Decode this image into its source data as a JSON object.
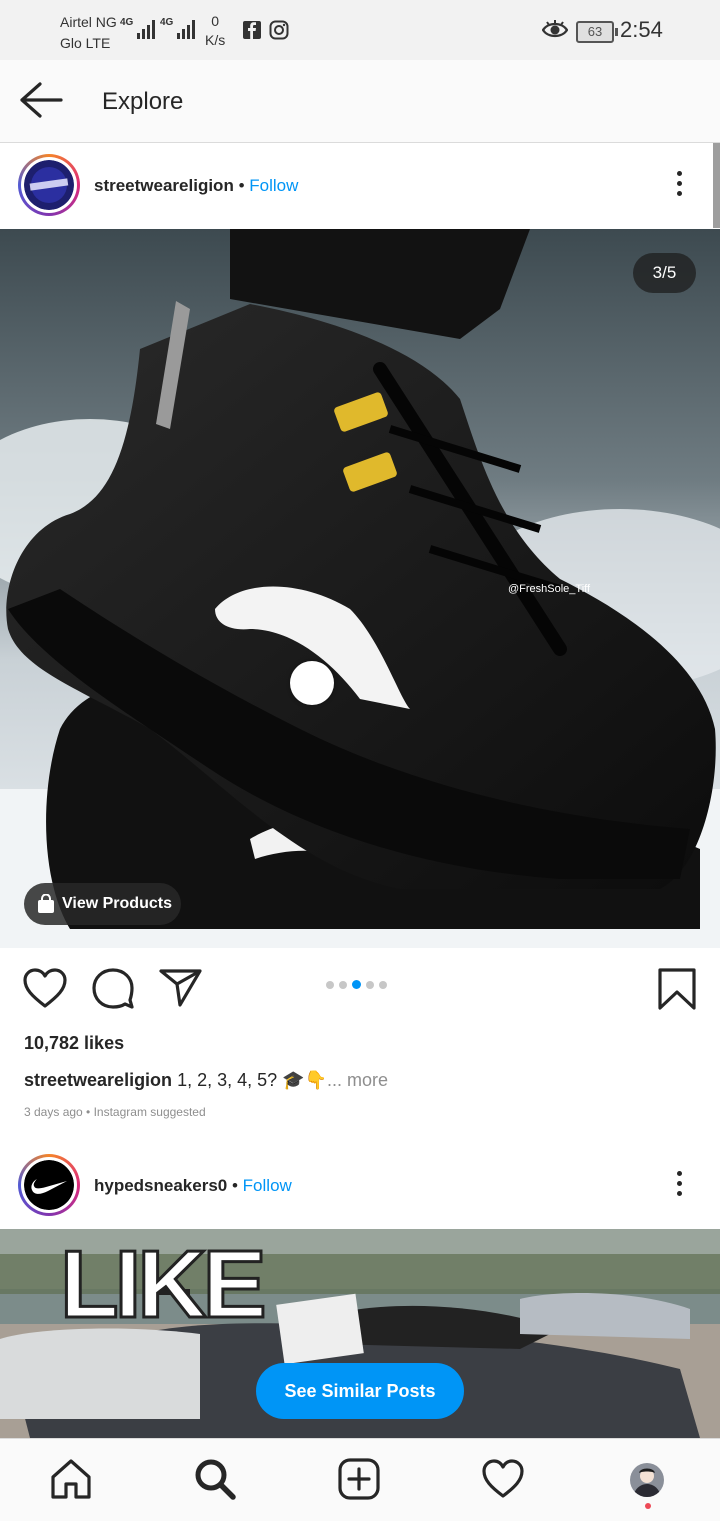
{
  "status_bar": {
    "carrier1": "Airtel NG",
    "carrier2": "Glo LTE",
    "network1": "4G",
    "network2": "4G",
    "speed_value": "0",
    "speed_unit": "K/s",
    "battery": "63",
    "time": "2:54"
  },
  "header": {
    "title": "Explore"
  },
  "post": {
    "username": "streetweareligion",
    "separator": "•",
    "follow_label": "Follow",
    "counter": "3/5",
    "watermark": "@FreshSole_Tiff",
    "view_products_label": "View Products",
    "carousel_index": 3,
    "carousel_total": 5,
    "likes": "10,782 likes",
    "caption_user": "streetweareligion",
    "caption_text": " 1, 2, 3, 4, 5? 🎓👇",
    "caption_more": "... more",
    "meta": "3 days ago • Instagram suggested"
  },
  "post2": {
    "username": "hypedsneakers0",
    "separator": "•",
    "follow_label": "Follow",
    "overlay_text": "LIKE",
    "see_similar_label": "See Similar Posts"
  },
  "colors": {
    "accent": "#0095f6",
    "text": "#262626",
    "muted": "#8e8e8e",
    "notification": "#ed4956"
  },
  "bottom_nav": {
    "items": [
      "home-icon",
      "search-icon",
      "new-post-icon",
      "activity-heart-icon",
      "profile-avatar"
    ]
  }
}
